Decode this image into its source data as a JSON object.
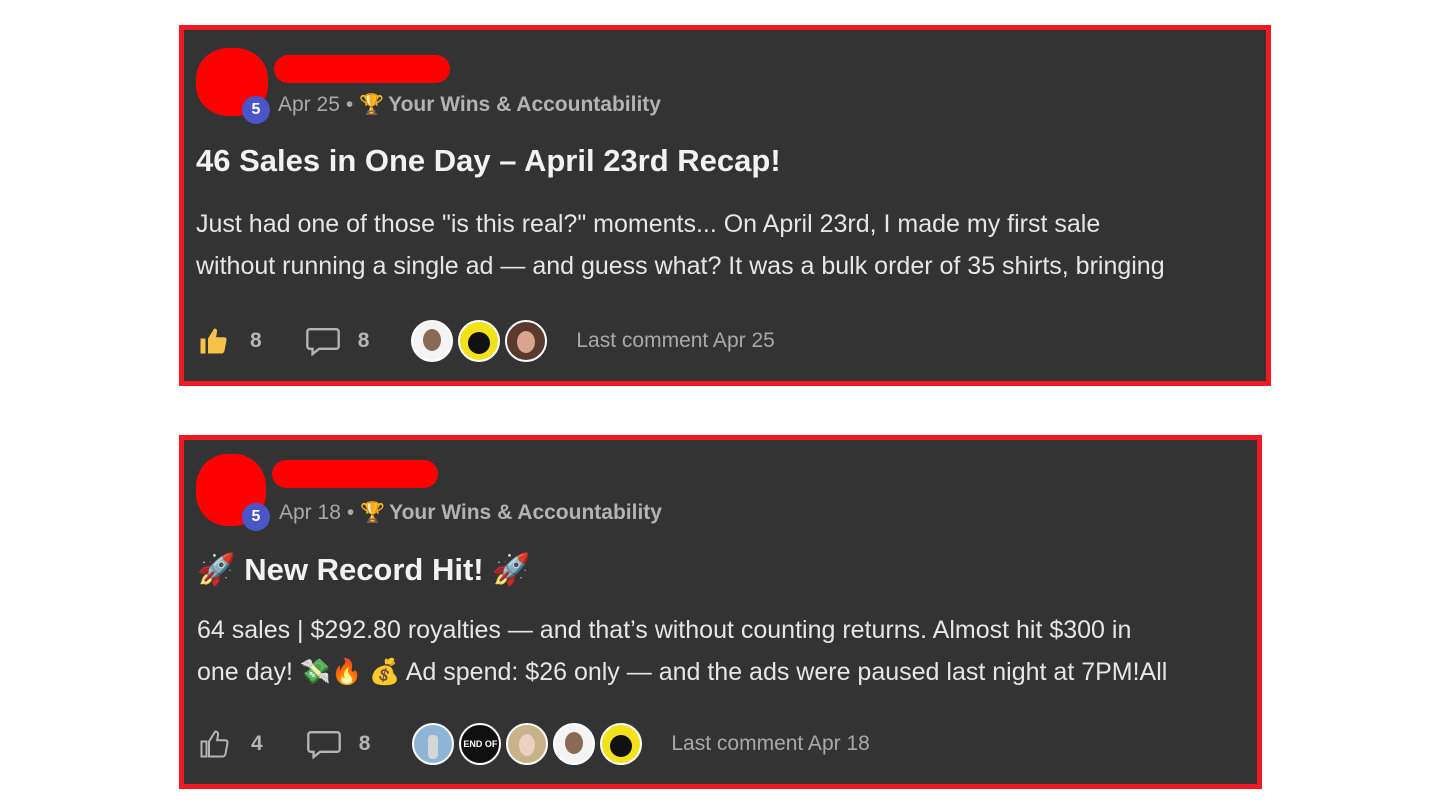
{
  "posts": [
    {
      "level": "5",
      "date": "Apr 25",
      "separator": "•",
      "category_icon": "trophy-icon",
      "category": "Your Wins & Accountability",
      "title": "46 Sales in One Day – April 23rd Recap!",
      "body_line1": "Just had one of those \"is this real?\" moments... On April 23rd, I made my first sale",
      "body_line2": "without running a single ad — and guess what? It was a bulk order of 35 shirts, bringing",
      "like_icon": "thumbs-up-filled-icon",
      "likes": "8",
      "comment_icon": "comment-bubble-icon",
      "comments": "8",
      "last_comment": "Last comment Apr 25"
    },
    {
      "level": "5",
      "date": "Apr 18",
      "separator": "•",
      "category_icon": "trophy-icon",
      "category": "Your Wins & Accountability",
      "title": "🚀 New Record Hit! 🚀",
      "body_line1": "64 sales | $292.80 royalties — and that’s without counting returns. Almost hit $300 in",
      "body_line2": "one day! 💸🔥 💰 Ad spend: $26 only — and the ads were paused last night at 7PM!All",
      "like_icon": "thumbs-up-outline-icon",
      "likes": "4",
      "comment_icon": "comment-bubble-icon",
      "comments": "8",
      "last_comment": "Last comment Apr 18",
      "avatar_text": "END OF AN ERROR"
    }
  ],
  "colors": {
    "card_bg": "#333333",
    "card_border": "#ee1a24",
    "redaction": "#ff0000",
    "level_badge": "#4a56c8",
    "like_active": "#f5c24a"
  }
}
